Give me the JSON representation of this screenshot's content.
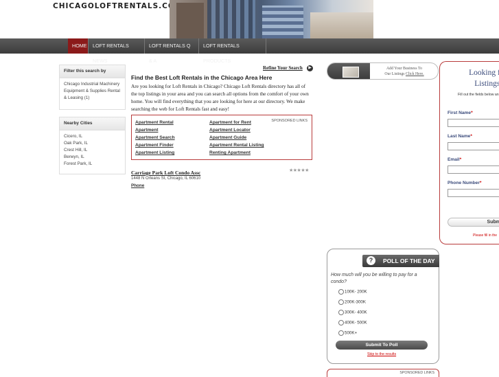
{
  "site": {
    "logo": "CHICAGOLOFTRENTALS.COM"
  },
  "nav": [
    {
      "label": "HOME",
      "active": true
    },
    {
      "label": "LOFT RENTALS NEWS"
    },
    {
      "label": "LOFT RENTALS Q & A"
    },
    {
      "label": "LOFT RENTALS PRODUCTS"
    }
  ],
  "sidebar": {
    "filter": {
      "title": "Filter this search by",
      "items": [
        "Chicago Industrial Machinery Equipment & Supplies Rental & Leasing (1)"
      ]
    },
    "cities": {
      "title": "Nearby Cities",
      "items": [
        "Cicero, IL",
        "Oak Park, IL",
        "Crest Hill, IL",
        "Berwyn, IL",
        "Forest Park, IL"
      ]
    }
  },
  "main": {
    "refine": "Refine Your Search",
    "title": "Find the Best Loft Rentals in the Chicago Area Here",
    "intro": "Are you looking for Loft Rentals in Chicago? Chicago Loft Rentals directory has all of the top listings in your area and you can search all options from the comfort of your own home. You will find everything that you are looking for here at our directory. We make searching the web for Loft Rentals fast and easy!",
    "sponsored_label": "SPONSORED LINKS",
    "links_left": [
      "Apartment Rental",
      "Apartment",
      "Apartment Search",
      "Apartment Finder",
      "Apartment Listing"
    ],
    "links_right": [
      "Apartment for Rent",
      "Apartment Locator",
      "Apartment Guide",
      "Apartment Rental Listing",
      "Renting Apartment"
    ],
    "listing": {
      "name": "Carriage Park Loft Condo Assc",
      "rating": "★★★★★",
      "address": "1448 N Orleans St, Chicago, IL 60610",
      "phone": "Phone"
    }
  },
  "addbiz": {
    "line1": "Add Your Business To",
    "line2": "Our Listings",
    "link": "Click Here."
  },
  "form": {
    "title_l1": "Looking for A",
    "title_l2": "Listings In",
    "subtitle": "Fill out the fields below and professional",
    "fields": [
      "First Name",
      "Last Name",
      "Email",
      "Phone Number"
    ],
    "submit": "Subm",
    "note": "Please fill in the"
  },
  "poll": {
    "title": "POLL OF THE DAY",
    "question": "How much will you be willing to pay for a condo?",
    "options": [
      "100K- 200K",
      "200K-300K",
      "300K- 400K",
      "400K- 500K",
      "500K+"
    ],
    "submit": "Submit To Poll",
    "results": "Skip to the results"
  },
  "sponsor2": {
    "label": "SPONSORED LINKS"
  }
}
